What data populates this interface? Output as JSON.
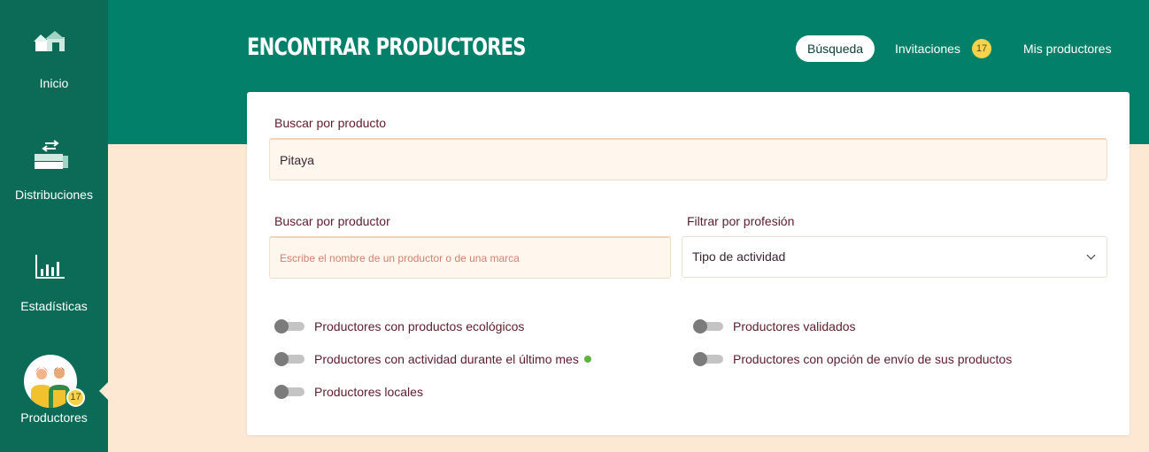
{
  "sidebar": {
    "items": [
      {
        "label": "Inicio",
        "icon": "home-icon"
      },
      {
        "label": "Distribuciones",
        "icon": "boxes-icon"
      },
      {
        "label": "Estadísticas",
        "icon": "bar-chart-icon"
      },
      {
        "label": "Productores",
        "icon": "producers-avatar-icon",
        "badge": "17",
        "active": true
      }
    ]
  },
  "header": {
    "title": "ENCONTRAR PRODUCTORES",
    "tabs": [
      {
        "label": "Búsqueda",
        "active": true
      },
      {
        "label": "Invitaciones",
        "badge": "17"
      },
      {
        "label": "Mis productores"
      }
    ]
  },
  "search": {
    "product_label": "Buscar por producto",
    "product_value": "Pitaya",
    "producer_label": "Buscar por productor",
    "producer_placeholder": "Escribe el nombre de un productor o de una marca",
    "profession_label": "Filtrar por profesión",
    "profession_selected": "Tipo de actividad"
  },
  "filters": [
    {
      "label": "Productores con productos ecológicos",
      "on": false
    },
    {
      "label": "Productores con actividad durante el último mes",
      "on": false
    },
    {
      "label": "Productores locales",
      "on": false
    },
    {
      "label": "Productores validados",
      "on": false
    },
    {
      "label": "Productores con opción de envío de sus productos",
      "on": false
    }
  ],
  "colors": {
    "sidebar": "#0b6b57",
    "header": "#02806a",
    "background": "#fde8d4",
    "badge": "#f6d34a",
    "label_text": "#5c1d2c",
    "activity_dot": "#5fb23f"
  }
}
